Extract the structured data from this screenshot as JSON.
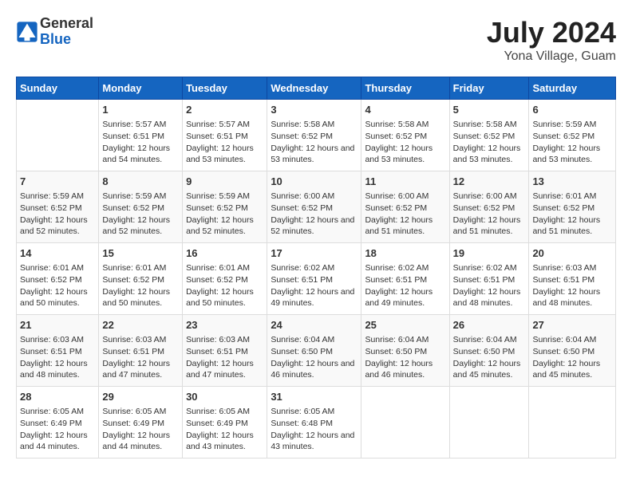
{
  "header": {
    "logo_general": "General",
    "logo_blue": "Blue",
    "month_year": "July 2024",
    "location": "Yona Village, Guam"
  },
  "days_of_week": [
    "Sunday",
    "Monday",
    "Tuesday",
    "Wednesday",
    "Thursday",
    "Friday",
    "Saturday"
  ],
  "weeks": [
    [
      {
        "day": "",
        "sunrise": "",
        "sunset": "",
        "daylight": ""
      },
      {
        "day": "1",
        "sunrise": "5:57 AM",
        "sunset": "6:51 PM",
        "daylight": "12 hours and 54 minutes."
      },
      {
        "day": "2",
        "sunrise": "5:57 AM",
        "sunset": "6:51 PM",
        "daylight": "12 hours and 53 minutes."
      },
      {
        "day": "3",
        "sunrise": "5:58 AM",
        "sunset": "6:52 PM",
        "daylight": "12 hours and 53 minutes."
      },
      {
        "day": "4",
        "sunrise": "5:58 AM",
        "sunset": "6:52 PM",
        "daylight": "12 hours and 53 minutes."
      },
      {
        "day": "5",
        "sunrise": "5:58 AM",
        "sunset": "6:52 PM",
        "daylight": "12 hours and 53 minutes."
      },
      {
        "day": "6",
        "sunrise": "5:59 AM",
        "sunset": "6:52 PM",
        "daylight": "12 hours and 53 minutes."
      }
    ],
    [
      {
        "day": "7",
        "sunrise": "5:59 AM",
        "sunset": "6:52 PM",
        "daylight": "12 hours and 52 minutes."
      },
      {
        "day": "8",
        "sunrise": "5:59 AM",
        "sunset": "6:52 PM",
        "daylight": "12 hours and 52 minutes."
      },
      {
        "day": "9",
        "sunrise": "5:59 AM",
        "sunset": "6:52 PM",
        "daylight": "12 hours and 52 minutes."
      },
      {
        "day": "10",
        "sunrise": "6:00 AM",
        "sunset": "6:52 PM",
        "daylight": "12 hours and 52 minutes."
      },
      {
        "day": "11",
        "sunrise": "6:00 AM",
        "sunset": "6:52 PM",
        "daylight": "12 hours and 51 minutes."
      },
      {
        "day": "12",
        "sunrise": "6:00 AM",
        "sunset": "6:52 PM",
        "daylight": "12 hours and 51 minutes."
      },
      {
        "day": "13",
        "sunrise": "6:01 AM",
        "sunset": "6:52 PM",
        "daylight": "12 hours and 51 minutes."
      }
    ],
    [
      {
        "day": "14",
        "sunrise": "6:01 AM",
        "sunset": "6:52 PM",
        "daylight": "12 hours and 50 minutes."
      },
      {
        "day": "15",
        "sunrise": "6:01 AM",
        "sunset": "6:52 PM",
        "daylight": "12 hours and 50 minutes."
      },
      {
        "day": "16",
        "sunrise": "6:01 AM",
        "sunset": "6:52 PM",
        "daylight": "12 hours and 50 minutes."
      },
      {
        "day": "17",
        "sunrise": "6:02 AM",
        "sunset": "6:51 PM",
        "daylight": "12 hours and 49 minutes."
      },
      {
        "day": "18",
        "sunrise": "6:02 AM",
        "sunset": "6:51 PM",
        "daylight": "12 hours and 49 minutes."
      },
      {
        "day": "19",
        "sunrise": "6:02 AM",
        "sunset": "6:51 PM",
        "daylight": "12 hours and 48 minutes."
      },
      {
        "day": "20",
        "sunrise": "6:03 AM",
        "sunset": "6:51 PM",
        "daylight": "12 hours and 48 minutes."
      }
    ],
    [
      {
        "day": "21",
        "sunrise": "6:03 AM",
        "sunset": "6:51 PM",
        "daylight": "12 hours and 48 minutes."
      },
      {
        "day": "22",
        "sunrise": "6:03 AM",
        "sunset": "6:51 PM",
        "daylight": "12 hours and 47 minutes."
      },
      {
        "day": "23",
        "sunrise": "6:03 AM",
        "sunset": "6:51 PM",
        "daylight": "12 hours and 47 minutes."
      },
      {
        "day": "24",
        "sunrise": "6:04 AM",
        "sunset": "6:50 PM",
        "daylight": "12 hours and 46 minutes."
      },
      {
        "day": "25",
        "sunrise": "6:04 AM",
        "sunset": "6:50 PM",
        "daylight": "12 hours and 46 minutes."
      },
      {
        "day": "26",
        "sunrise": "6:04 AM",
        "sunset": "6:50 PM",
        "daylight": "12 hours and 45 minutes."
      },
      {
        "day": "27",
        "sunrise": "6:04 AM",
        "sunset": "6:50 PM",
        "daylight": "12 hours and 45 minutes."
      }
    ],
    [
      {
        "day": "28",
        "sunrise": "6:05 AM",
        "sunset": "6:49 PM",
        "daylight": "12 hours and 44 minutes."
      },
      {
        "day": "29",
        "sunrise": "6:05 AM",
        "sunset": "6:49 PM",
        "daylight": "12 hours and 44 minutes."
      },
      {
        "day": "30",
        "sunrise": "6:05 AM",
        "sunset": "6:49 PM",
        "daylight": "12 hours and 43 minutes."
      },
      {
        "day": "31",
        "sunrise": "6:05 AM",
        "sunset": "6:48 PM",
        "daylight": "12 hours and 43 minutes."
      },
      {
        "day": "",
        "sunrise": "",
        "sunset": "",
        "daylight": ""
      },
      {
        "day": "",
        "sunrise": "",
        "sunset": "",
        "daylight": ""
      },
      {
        "day": "",
        "sunrise": "",
        "sunset": "",
        "daylight": ""
      }
    ]
  ]
}
